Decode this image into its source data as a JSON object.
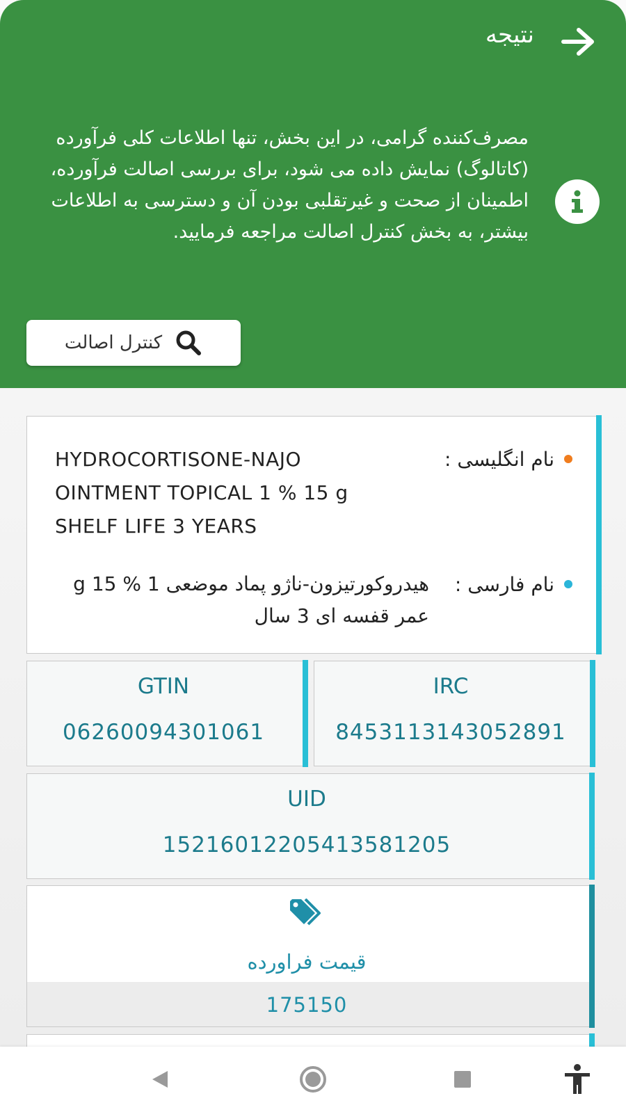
{
  "header": {
    "title": "نتیجه",
    "info_text": "مصرف‌کننده گرامی، در این بخش، تنها اطلاعات کلی فرآورده (کاتالوگ) نمایش داده می شود، برای بررسی اصالت فرآورده، اطمینان از صحت و غیرتقلبی بودن آن و دسترسی به اطلاعات بیشتر، به بخش کنترل اصالت مراجعه فرمایید.",
    "auth_button_label": "کنترل اصالت"
  },
  "names": {
    "english_label": "نام انگلیسی :",
    "english_lines": [
      "HYDROCORTISONE-NAJO",
      "OINTMENT TOPICAL 1 % 15 g",
      "SHELF LIFE 3 YEARS"
    ],
    "persian_label": "نام فارسی :",
    "persian_value": "هیدروکورتیزون-ناژو پماد موضعی 1 % 15 g عمر قفسه ای 3 سال"
  },
  "ids": {
    "gtin_label": "GTIN",
    "gtin_value": "06260094301061",
    "irc_label": "IRC",
    "irc_value": "8453113143052891",
    "uid_label": "UID",
    "uid_value": "15216012205413581205"
  },
  "price": {
    "label": "قیمت فراورده",
    "value": "175150",
    "icon": "tags-icon"
  },
  "colors": {
    "header_green": "#3a9142",
    "accent_teal": "#1c7b8c",
    "card_bar": "#29bfd6",
    "dot_orange": "#f07d1e",
    "dot_blue": "#2bb5d9"
  }
}
